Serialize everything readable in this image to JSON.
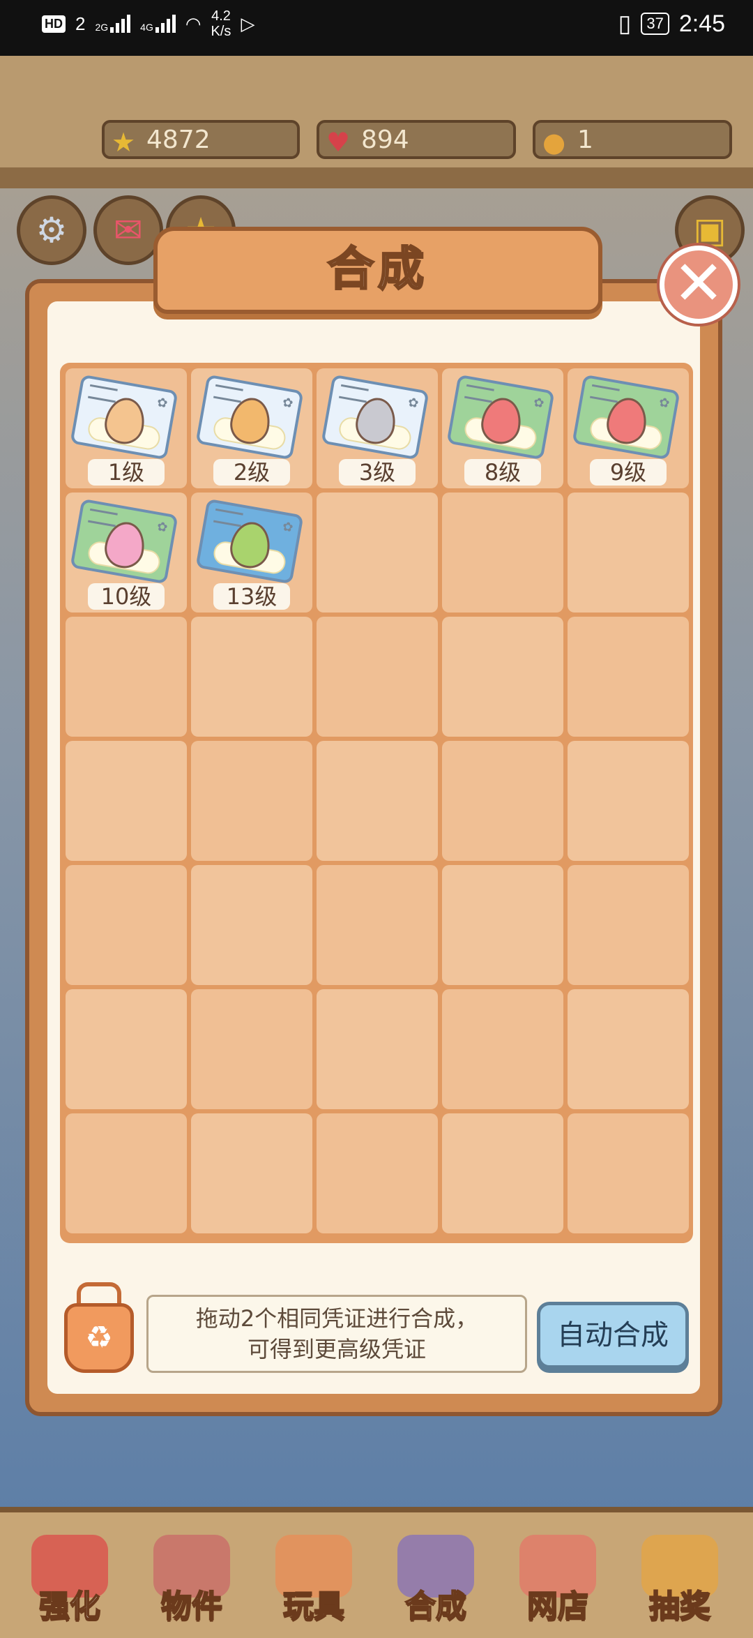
{
  "status_bar": {
    "hd": "HD",
    "sim_slot": "2",
    "net1": "2G",
    "net2": "4G",
    "speed_value": "4.2",
    "speed_unit": "K/s",
    "battery": "37",
    "time": "2:45"
  },
  "resources": {
    "stars": "4872",
    "hearts": "894",
    "paws": "1"
  },
  "dialog": {
    "title": "合成",
    "close_icon": "close-x-icon",
    "slots": [
      {
        "level": "1级",
        "card_color": "#e9f2fb",
        "egg_color": "#f4c48f"
      },
      {
        "level": "2级",
        "card_color": "#e9f2fb",
        "egg_color": "#f2b86d"
      },
      {
        "level": "3级",
        "card_color": "#e9f2fb",
        "egg_color": "#c9c9d0"
      },
      {
        "level": "8级",
        "card_color": "#9fd39a",
        "egg_color": "#ef7a7a"
      },
      {
        "level": "9级",
        "card_color": "#9fd39a",
        "egg_color": "#ef7a7a"
      },
      {
        "level": "10级",
        "card_color": "#9fd39a",
        "egg_color": "#f4a8c8"
      },
      {
        "level": "13级",
        "card_color": "#6fb0df",
        "egg_color": "#a9d36d"
      }
    ],
    "total_slots": 35,
    "hint_line1": "拖动2个相同凭证进行合成，",
    "hint_line2": "可得到更高级凭证",
    "auto_merge": "自动合成"
  },
  "nav": [
    {
      "label": "强化",
      "color": "#d9564f"
    },
    {
      "label": "物件",
      "color": "#c9706a"
    },
    {
      "label": "玩具",
      "color": "#e58f5a"
    },
    {
      "label": "合成",
      "color": "#8c76b4"
    },
    {
      "label": "网店",
      "color": "#e07b6a"
    },
    {
      "label": "抽奖",
      "color": "#e2a449"
    }
  ]
}
